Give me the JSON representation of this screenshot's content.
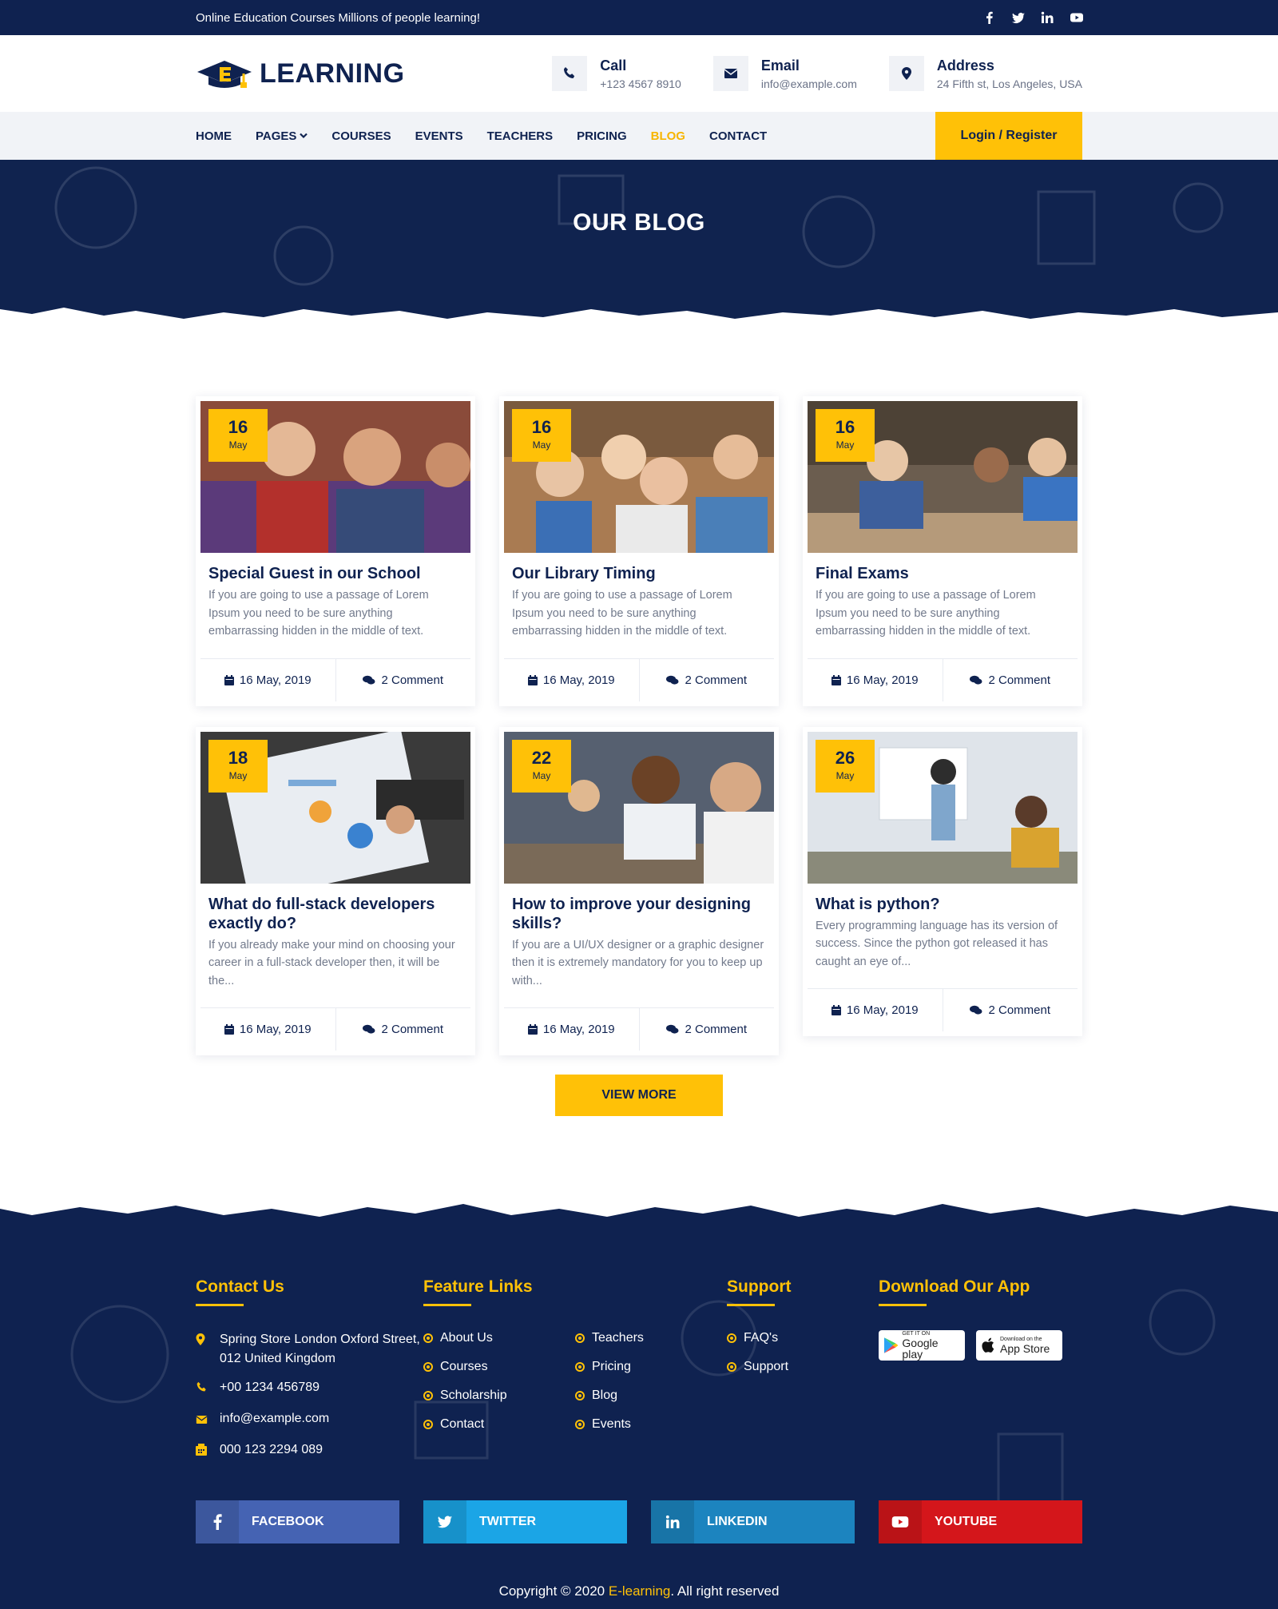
{
  "topbar": {
    "tagline": "Online Education Courses Millions of people learning!",
    "social_icons": [
      "facebook-icon",
      "twitter-icon",
      "linkedin-icon",
      "youtube-icon"
    ]
  },
  "header": {
    "logo_letter": "E",
    "logo_text": "LEARNING",
    "contacts": [
      {
        "label": "Call",
        "value": "+123 4567 8910",
        "icon": "phone-icon"
      },
      {
        "label": "Email",
        "value": "info@example.com",
        "icon": "envelope-icon"
      },
      {
        "label": "Address",
        "value": "24 Fifth st, Los Angeles, USA",
        "icon": "map-pin-icon"
      }
    ]
  },
  "nav": {
    "items": [
      {
        "label": "HOME"
      },
      {
        "label": "PAGES"
      },
      {
        "label": "COURSES"
      },
      {
        "label": "EVENTS"
      },
      {
        "label": "TEACHERS"
      },
      {
        "label": "PRICING"
      },
      {
        "label": "BLOG",
        "active": true
      },
      {
        "label": "CONTACT"
      }
    ],
    "login_label": "Login / Register"
  },
  "banner": {
    "title": "OUR BLOG"
  },
  "posts": [
    {
      "day": "16",
      "month": "May",
      "title": "Special Guest in our School",
      "excerpt": "If you are going to use a passage of Lorem Ipsum you need to be sure anything embarrassing hidden in the middle of text.",
      "date": "16 May, 2019",
      "comments": "2 Comment"
    },
    {
      "day": "16",
      "month": "May",
      "title": "Our Library Timing",
      "excerpt": "If you are going to use a passage of Lorem Ipsum you need to be sure anything embarrassing hidden in the middle of text.",
      "date": "16 May, 2019",
      "comments": "2 Comment"
    },
    {
      "day": "16",
      "month": "May",
      "title": "Final Exams",
      "excerpt": "If you are going to use a passage of Lorem Ipsum you need to be sure anything embarrassing hidden in the middle of text.",
      "date": "16 May, 2019",
      "comments": "2 Comment"
    },
    {
      "day": "18",
      "month": "May",
      "title": "What do full-stack developers exactly do?",
      "excerpt": "If you already make your mind on choosing your career in a full-stack developer then, it will be the...",
      "date": "16 May, 2019",
      "comments": "2 Comment"
    },
    {
      "day": "22",
      "month": "May",
      "title": "How to improve your designing skills?",
      "excerpt": "If you are a UI/UX designer or a graphic designer then it is extremely mandatory for you to keep up with...",
      "date": "16 May, 2019",
      "comments": "2 Comment"
    },
    {
      "day": "26",
      "month": "May",
      "title": "What is python?",
      "excerpt": "Every programming language has its version of success. Since the python got released it has caught an eye of...",
      "date": "16 May, 2019",
      "comments": "2 Comment"
    }
  ],
  "view_more_label": "VIEW MORE",
  "footer": {
    "contact": {
      "heading": "Contact Us",
      "address": "Spring Store London Oxford Street, 012 United Kingdom",
      "phone": "+00 1234 456789",
      "email": "info@example.com",
      "fax": "000 123 2294 089"
    },
    "features": {
      "heading": "Feature Links",
      "col1": [
        "About Us",
        "Courses",
        "Scholarship",
        "Contact"
      ],
      "col2": [
        "Teachers",
        "Pricing",
        "Blog",
        "Events"
      ]
    },
    "support": {
      "heading": "Support",
      "items": [
        "FAQ's",
        "Support"
      ]
    },
    "app": {
      "heading": "Download Our App",
      "google_small": "GET IT ON",
      "google_big": "Google play",
      "apple_small": "Download on the",
      "apple_big": "App Store"
    },
    "social_buttons": [
      {
        "label": "FACEBOOK",
        "color": "#3b5998",
        "icon": "facebook-icon"
      },
      {
        "label": "TWITTER",
        "color": "#1da1f2",
        "icon": "twitter-icon"
      },
      {
        "label": "LINKEDIN",
        "color": "#0e76a8",
        "icon": "linkedin-icon"
      },
      {
        "label": "YOUTUBE",
        "color": "#d91c1c",
        "icon": "youtube-icon"
      }
    ],
    "copyright_prefix": "Copyright © 2020 ",
    "copyright_brand": "E-learning",
    "copyright_suffix": ". All right reserved"
  },
  "colors": {
    "navy": "#0f2250",
    "accent": "#ffc107",
    "active_nav": "#f7b500"
  }
}
